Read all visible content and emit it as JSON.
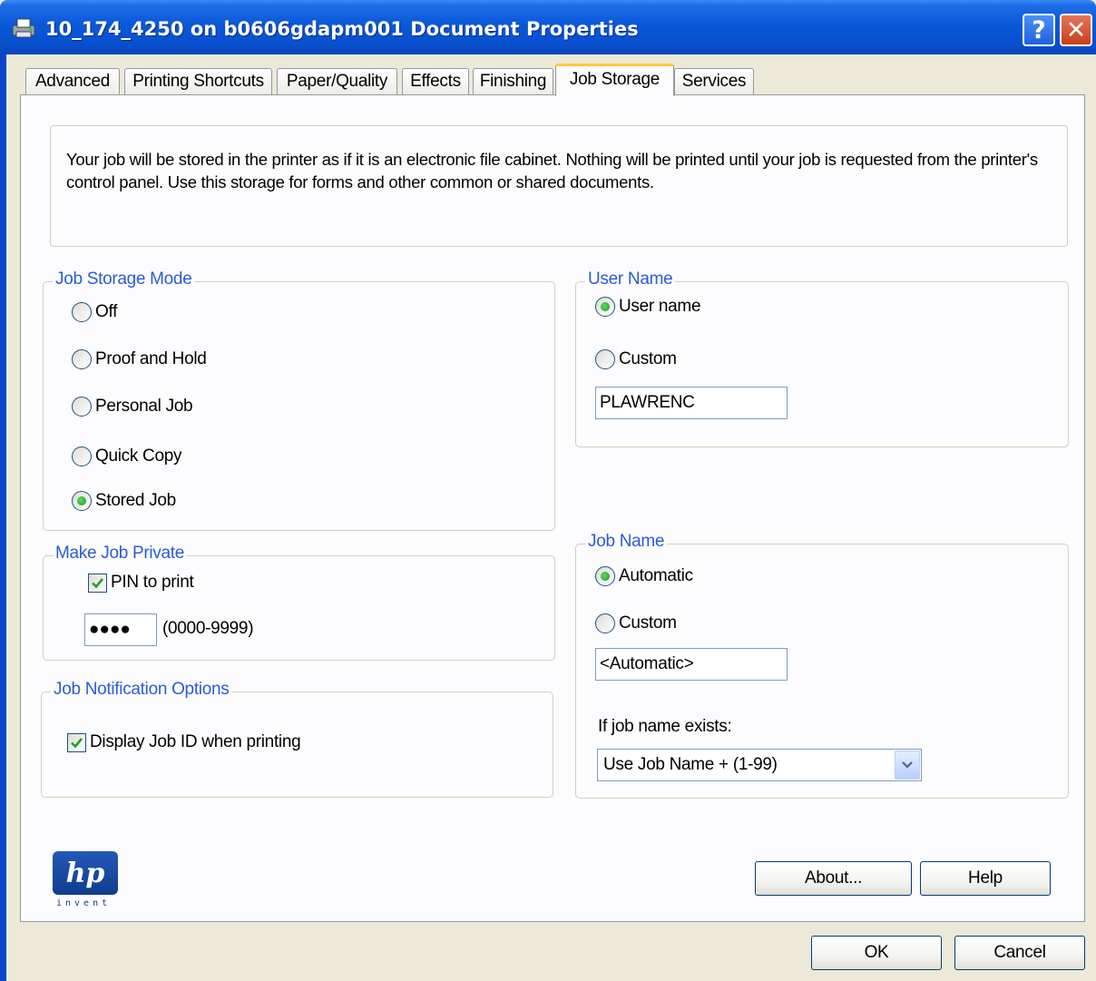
{
  "window": {
    "title": "10_174_4250 on b0606gdapm001 Document Properties",
    "help_glyph": "?",
    "close_glyph": "✕"
  },
  "tabs": [
    {
      "label": "Advanced"
    },
    {
      "label": "Printing Shortcuts"
    },
    {
      "label": "Paper/Quality"
    },
    {
      "label": "Effects"
    },
    {
      "label": "Finishing"
    },
    {
      "label": "Job Storage",
      "active": true
    },
    {
      "label": "Services"
    }
  ],
  "description": "Your job will be stored in the printer as if it is an electronic file cabinet. Nothing will be printed until your job is requested from the printer's control panel. Use this storage for forms and other common or shared documents.",
  "job_storage_mode": {
    "legend": "Job Storage Mode",
    "options": [
      {
        "label": "Off",
        "checked": false
      },
      {
        "label": "Proof and Hold",
        "checked": false
      },
      {
        "label": "Personal Job",
        "checked": false
      },
      {
        "label": "Quick Copy",
        "checked": false
      },
      {
        "label": "Stored Job",
        "checked": true
      }
    ]
  },
  "make_job_private": {
    "legend": "Make Job Private",
    "pin_label": "PIN to print",
    "pin_checked": true,
    "pin_value": "●●●●",
    "pin_range": "(0000-9999)"
  },
  "job_notification": {
    "legend": "Job Notification Options",
    "display_label": "Display Job ID when printing",
    "display_checked": true
  },
  "user_name": {
    "legend": "User Name",
    "options": [
      {
        "label": "User name",
        "checked": true
      },
      {
        "label": "Custom",
        "checked": false
      }
    ],
    "value": "PLAWRENC"
  },
  "job_name": {
    "legend": "Job Name",
    "options": [
      {
        "label": "Automatic",
        "checked": true
      },
      {
        "label": "Custom",
        "checked": false
      }
    ],
    "value": "<Automatic>",
    "exists_label": "If job name exists:",
    "exists_selected": "Use Job Name + (1-99)"
  },
  "logo": {
    "mark": "hp",
    "tagline": "invent"
  },
  "buttons": {
    "about": "About...",
    "help": "Help",
    "ok": "OK",
    "cancel": "Cancel"
  },
  "colors": {
    "title_bar": "#0a58d8",
    "legend_text": "#2a5bd7",
    "active_tab_highlight": "#ffc83c",
    "radio_selected": "#219821"
  }
}
